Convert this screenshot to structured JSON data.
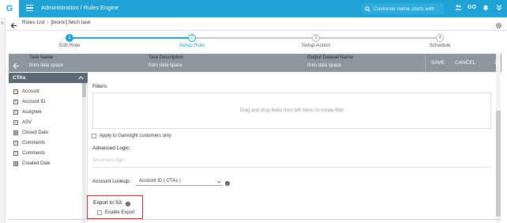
{
  "topbar": {
    "logo": "G",
    "title": "Administration / Rules Engine",
    "search_placeholder": "Customer name starts with",
    "go_label": "GO"
  },
  "breadcrumb": {
    "root": "Rules List",
    "separator": "/",
    "current": "[bionic] fetch task"
  },
  "steps": [
    {
      "number": "1",
      "label": "Edit Rule",
      "state": "done"
    },
    {
      "number": "2",
      "label": "Setup Rule",
      "state": "active"
    },
    {
      "number": "3",
      "label": "Setup Action",
      "state": "pending"
    },
    {
      "number": "4",
      "label": "Schedule",
      "state": "pending"
    }
  ],
  "task_header": {
    "task_name_label": "Task Name",
    "task_name_value": "from data space",
    "task_description_label": "Task Description",
    "task_description_value": "from data space",
    "output_dataset_label": "Output Dataset Name",
    "output_dataset_value": "from data space",
    "save_label": "SAVE",
    "cancel_label": "CANCEL"
  },
  "left_panel": {
    "title": "CTAs",
    "fields": [
      {
        "label": "Account",
        "icon": "text-field-icon"
      },
      {
        "label": "Account ID",
        "icon": "text-field-icon"
      },
      {
        "label": "Assignee",
        "icon": "text-field-icon"
      },
      {
        "label": "ASV",
        "icon": "number-field-icon"
      },
      {
        "label": "Closed Date",
        "icon": "calendar-icon"
      },
      {
        "label": "Comments",
        "icon": "text-field-icon"
      },
      {
        "label": "Comments",
        "icon": "text-field-icon"
      },
      {
        "label": "Created Date",
        "icon": "calendar-icon"
      }
    ]
  },
  "main": {
    "filters_label": "Filters:",
    "dropzone_text": "Drag and drop fields from left menu to create filter",
    "apply_gainsight_label": "Apply to Gainsight customers only",
    "advanced_logic_label": "Advanced Logic:",
    "advanced_logic_placeholder": "Advanced logic",
    "account_lookup_label": "Account Lookup:",
    "account_lookup_value": "Account ID ( CTAs )",
    "export_label": "Export to S3:",
    "enable_export_label": "Enable Export"
  },
  "colors": {
    "brand": "#1fa2d6",
    "task_header": "#8d969c",
    "panel_header": "#5b6a75",
    "highlight": "#d4202a"
  }
}
